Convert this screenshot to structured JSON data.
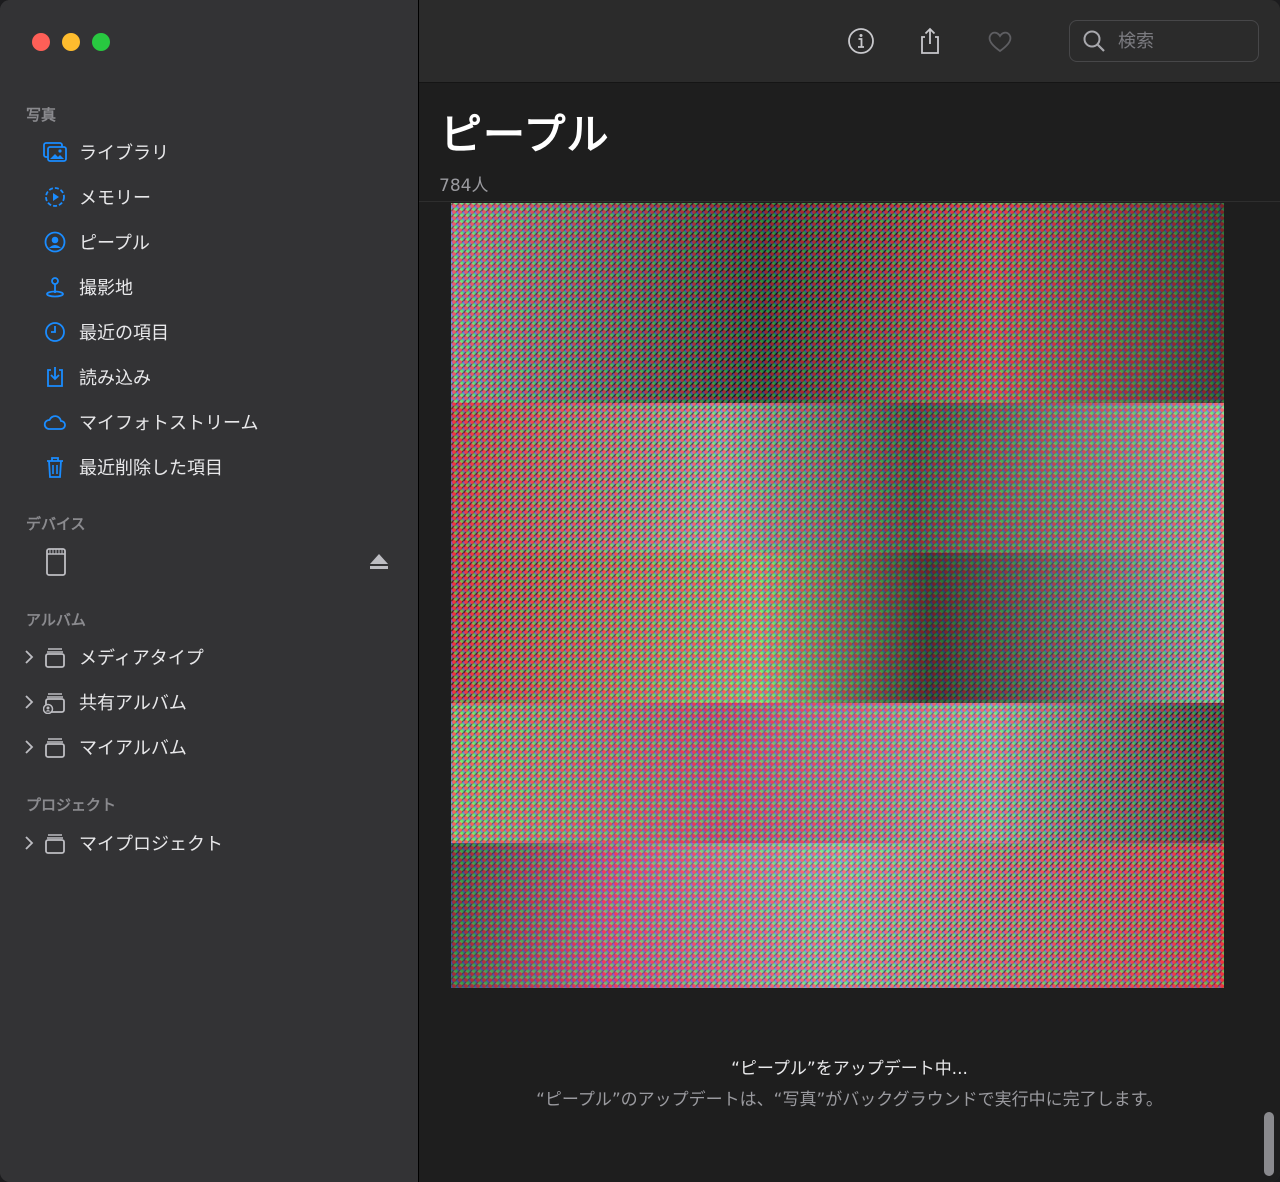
{
  "window": {
    "traffic_lights": [
      "close",
      "minimize",
      "zoom"
    ]
  },
  "sidebar": {
    "sections": {
      "photos": "写真",
      "devices": "デバイス",
      "albums": "アルバム",
      "projects": "プロジェクト"
    },
    "photos_items": [
      {
        "label": "ライブラリ",
        "icon": "photo-library-icon"
      },
      {
        "label": "メモリー",
        "icon": "memories-icon"
      },
      {
        "label": "ピープル",
        "icon": "people-icon"
      },
      {
        "label": "撮影地",
        "icon": "places-icon"
      },
      {
        "label": "最近の項目",
        "icon": "clock-icon"
      },
      {
        "label": "読み込み",
        "icon": "import-icon"
      },
      {
        "label": "マイフォトストリーム",
        "icon": "cloud-icon"
      },
      {
        "label": "最近削除した項目",
        "icon": "trash-icon"
      }
    ],
    "album_items": [
      {
        "label": "メディアタイプ",
        "icon": "album-stack-icon"
      },
      {
        "label": "共有アルバム",
        "icon": "shared-album-icon"
      },
      {
        "label": "マイアルバム",
        "icon": "album-stack-icon"
      }
    ],
    "project_items": [
      {
        "label": "マイプロジェクト",
        "icon": "album-stack-icon"
      }
    ]
  },
  "toolbar": {
    "search_placeholder": "検索"
  },
  "main": {
    "title": "ピープル",
    "count": "784人",
    "status_title": "“ピープル”をアップデート中...",
    "status_subtitle": "“ピープル”のアップデートは、“写真”がバックグラウンドで実行中に完了します。"
  },
  "colors": {
    "accent": "#1a8cff",
    "sidebar_bg": "#333335",
    "main_bg": "#1e1e1e"
  }
}
